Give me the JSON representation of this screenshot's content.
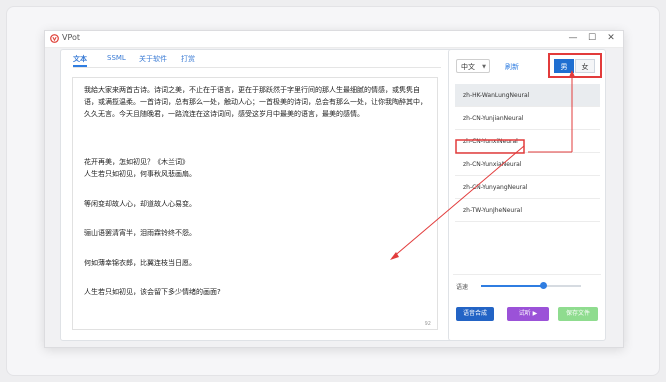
{
  "window": {
    "title": "VPot",
    "controls": {
      "minimize": "—",
      "maximize": "☐",
      "close": "✕"
    }
  },
  "tabs": [
    {
      "label": "文本"
    },
    {
      "label": "SSML"
    },
    {
      "label": "关于软件"
    },
    {
      "label": "打赏"
    }
  ],
  "editor": {
    "paragraphs": [
      "我給大家来两首古诗。诗词之美，不止在于语言，更在于那跃然于字里行间的那人生最细腻的情感，或隽隽自语，或满揽温柔。一首诗词，总有那么一处，触动人心；一首极美的诗词，总会有那么一处，让你我陶醉其中，久久无言。今天且随晚君，一路流连在这诗词间，感受这岁月中最美的语言，最美的感情。",
      "花开再美，怎如初见？《木兰词》",
      "人生若只如初见，何事秋风悲画扇。",
      "等闲变却故人心，却道故人心易变。",
      "骊山语罢清宵半，泪雨霖铃终不怨。",
      "何如薄幸锦衣郎，比翼连枝当日愿。",
      "人生若只如初见，该会留下多少情绪的画面?"
    ],
    "char_count": "92"
  },
  "language": {
    "selected": "中文",
    "refresh_label": "刷新"
  },
  "gender": {
    "male": "男",
    "female": "女",
    "selected": "男"
  },
  "voices": [
    "zh-HK-WanLungNeural",
    "zh-CN-YunjianNeural",
    "zh-CN-YunxiNeural",
    "zh-CN-YunxiaNeural",
    "zh-CN-YunyangNeural",
    "zh-TW-YunJheNeural"
  ],
  "selected_voice_index": 0,
  "highlighted_voice_index": 2,
  "speed": {
    "label": "语速",
    "value": 0.62
  },
  "actions": {
    "synthesize": "语音合成",
    "preview": "试听",
    "save": "保存文件"
  },
  "colors": {
    "accent": "#2f7de1",
    "annotation": "#e23b3b",
    "preview": "#9b52d8",
    "save": "#8fdc8f"
  }
}
